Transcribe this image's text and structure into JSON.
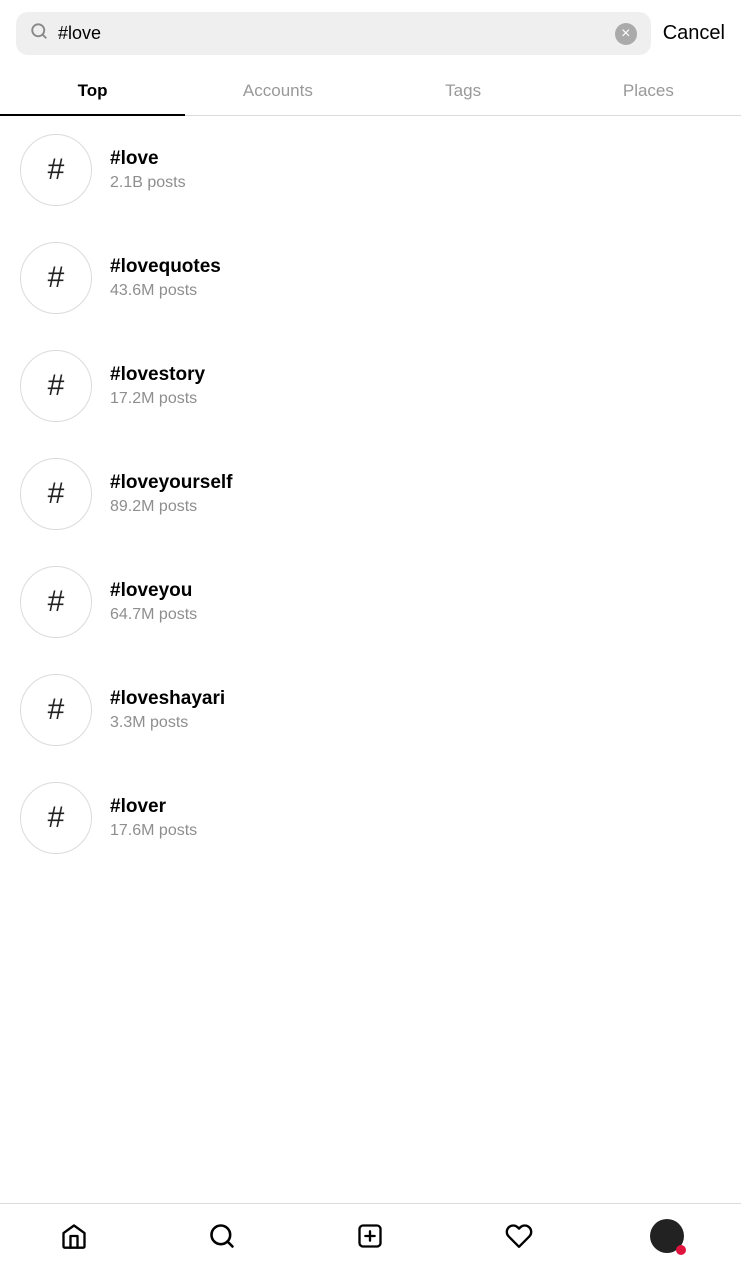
{
  "search": {
    "query": "#love",
    "placeholder": "Search",
    "clear_label": "×",
    "cancel_label": "Cancel"
  },
  "tabs": [
    {
      "id": "top",
      "label": "Top",
      "active": true
    },
    {
      "id": "accounts",
      "label": "Accounts",
      "active": false
    },
    {
      "id": "tags",
      "label": "Tags",
      "active": false
    },
    {
      "id": "places",
      "label": "Places",
      "active": false
    }
  ],
  "hashtags": [
    {
      "name": "#love",
      "posts": "2.1B posts"
    },
    {
      "name": "#lovequotes",
      "posts": "43.6M posts"
    },
    {
      "name": "#lovestory",
      "posts": "17.2M posts"
    },
    {
      "name": "#loveyourself",
      "posts": "89.2M posts"
    },
    {
      "name": "#loveyou",
      "posts": "64.7M posts"
    },
    {
      "name": "#loveshayari",
      "posts": "3.3M posts"
    },
    {
      "name": "#lover",
      "posts": "17.6M posts"
    }
  ],
  "bottom_nav": {
    "home_label": "home",
    "search_label": "search",
    "post_label": "new post",
    "activity_label": "activity",
    "profile_label": "profile"
  }
}
